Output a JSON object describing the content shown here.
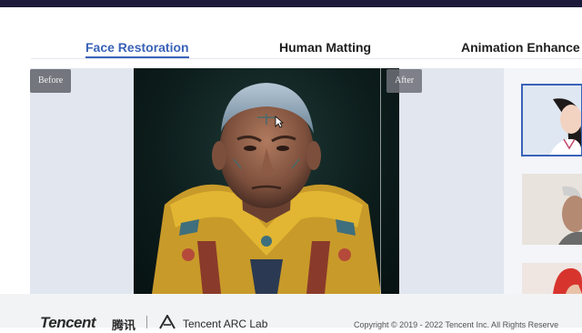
{
  "tabs": [
    {
      "label": "Face Restoration",
      "active": true
    },
    {
      "label": "Human Matting",
      "active": false
    },
    {
      "label": "Animation Enhance",
      "active": false
    }
  ],
  "comparison": {
    "before_label": "Before",
    "after_label": "After",
    "image": "elderly-man-tribal-portrait",
    "split_position_percent": 93
  },
  "thumbnails": [
    {
      "name": "thumb-young-woman",
      "selected": true
    },
    {
      "name": "thumb-elderly-man",
      "selected": false
    },
    {
      "name": "thumb-red-headwear",
      "selected": false
    }
  ],
  "footer": {
    "brand": "Tencent",
    "brand_cn": "腾讯",
    "lab": "Tencent ARC Lab",
    "copyright": "Copyright © 2019 - 2022 Tencent Inc. All Rights Reserve"
  },
  "colors": {
    "accent": "#3a63b8",
    "topbar": "#1b1a3a",
    "stage_bg": "#e1e6ef"
  }
}
